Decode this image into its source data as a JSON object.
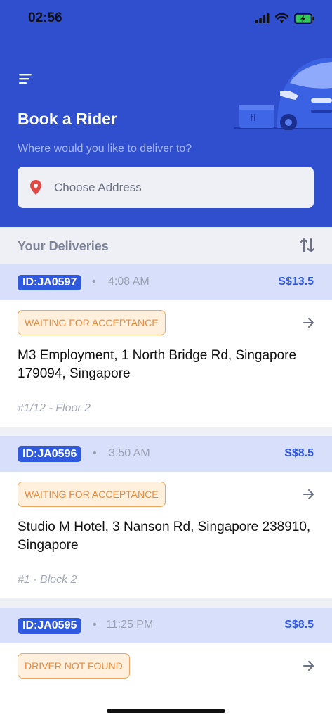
{
  "status_bar": {
    "time": "02:56",
    "icons": [
      "signal-icon",
      "wifi-icon",
      "battery-charging-icon"
    ]
  },
  "header": {
    "menu_icon": "menu-icon",
    "title": "Book a Rider",
    "subtitle": "Where would you like to deliver to?",
    "address_placeholder": "Choose Address",
    "address_value": ""
  },
  "deliveries": {
    "title": "Your Deliveries",
    "sort_icon": "sort-icon",
    "items": [
      {
        "id": "ID:JA0597",
        "dot": "•",
        "time": "4:08 AM",
        "price": "S$13.5",
        "status": "WAITING FOR ACCEPTANCE",
        "address": "M3 Employment, 1 North Bridge Rd, Singapore 179094, Singapore",
        "unit": "#1/12 - Floor 2"
      },
      {
        "id": "ID:JA0596",
        "dot": "•",
        "time": "3:50 AM",
        "price": "S$8.5",
        "status": "WAITING FOR ACCEPTANCE",
        "address": "Studio M Hotel, 3 Nanson Rd, Singapore 238910, Singapore",
        "unit": "#1 - Block 2"
      },
      {
        "id": "ID:JA0595",
        "dot": "•",
        "time": "11:25 PM",
        "price": "S$8.5",
        "status": "DRIVER NOT FOUND",
        "address": "",
        "unit": ""
      }
    ]
  },
  "colors": {
    "brand": "#2f4fcf",
    "accent": "#2f5ae0",
    "status_orange": "#ea8a3a",
    "status_bg": "#fff0dd",
    "card_header_bg": "#d8dffa"
  }
}
